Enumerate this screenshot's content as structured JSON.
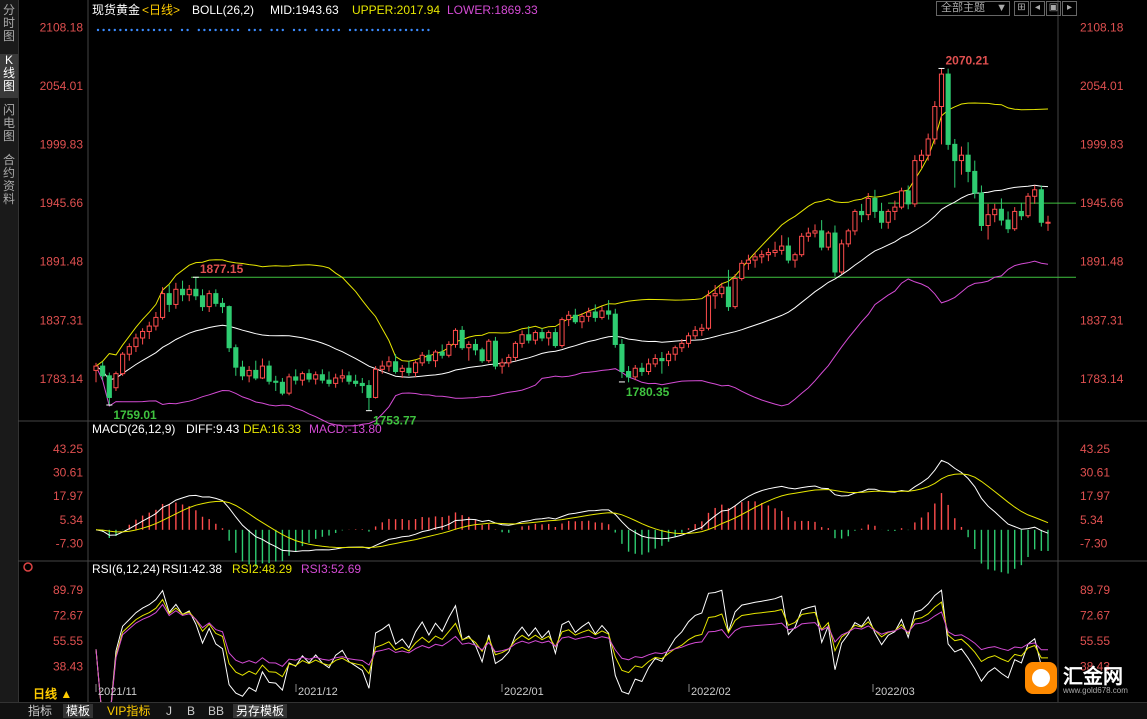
{
  "sidebar": {
    "tabs": [
      {
        "label": "分时图",
        "active": false
      },
      {
        "label": "K线图",
        "active": true
      },
      {
        "label": "闪电图",
        "active": false
      },
      {
        "label": "合约资料",
        "active": false
      }
    ]
  },
  "header": {
    "instrument": "现货黄金",
    "period": "<日线>",
    "boll_label": "BOLL(26,2)",
    "mid": "MID:1943.63",
    "upper": "UPPER:2017.94",
    "lower": "LOWER:1869.33",
    "dropdown": "全部主题",
    "colors": {
      "mid": "#ffffff",
      "upper": "#e6e600",
      "lower": "#d44bd4",
      "up": "#ff4d4d",
      "down": "#2ecc71"
    }
  },
  "bottom": {
    "period_btn": "日线 ▲",
    "tabs": [
      "指标",
      "模板",
      "VIP指标",
      "J",
      "B",
      "BB",
      "另存模板"
    ],
    "dates": [
      "2021/11",
      "2021/12",
      "2022/01",
      "2022/02",
      "2022/03"
    ]
  },
  "logo": {
    "text": "汇金网",
    "url_text": "www.gold678.com"
  },
  "chart_data": [
    {
      "type": "candlestick",
      "title": "现货黄金<日线>",
      "indicator": "BOLL(26,2)",
      "ylim": [
        1747,
        2115
      ],
      "y_ticks": [
        "2108.18",
        "2054.01",
        "1999.83",
        "1945.66",
        "1891.48",
        "1837.31",
        "1783.14"
      ],
      "annotations": [
        {
          "label": "1877.15",
          "bar": 15
        },
        {
          "label": "1759.01",
          "bar": 2
        },
        {
          "label": "1753.77",
          "bar": 41
        },
        {
          "label": "1780.35",
          "bar": 79
        },
        {
          "label": "2070.21",
          "bar": 127
        }
      ],
      "hlines": [
        1945.66,
        1877.15
      ],
      "ohlc": [
        [
          1791,
          1798,
          1780,
          1795
        ],
        [
          1795,
          1799,
          1782,
          1786
        ],
        [
          1786,
          1789,
          1759,
          1766
        ],
        [
          1775,
          1790,
          1772,
          1788
        ],
        [
          1788,
          1808,
          1786,
          1806
        ],
        [
          1806,
          1816,
          1800,
          1813
        ],
        [
          1813,
          1825,
          1808,
          1821
        ],
        [
          1821,
          1830,
          1815,
          1827
        ],
        [
          1827,
          1836,
          1820,
          1832
        ],
        [
          1832,
          1845,
          1828,
          1840
        ],
        [
          1840,
          1868,
          1838,
          1862
        ],
        [
          1862,
          1870,
          1845,
          1852
        ],
        [
          1852,
          1872,
          1848,
          1866
        ],
        [
          1866,
          1874,
          1855,
          1861
        ],
        [
          1861,
          1870,
          1855,
          1866
        ],
        [
          1866,
          1877,
          1856,
          1860
        ],
        [
          1860,
          1866,
          1846,
          1850
        ],
        [
          1850,
          1865,
          1845,
          1862
        ],
        [
          1862,
          1866,
          1850,
          1853
        ],
        [
          1853,
          1858,
          1844,
          1850
        ],
        [
          1850,
          1851,
          1808,
          1812
        ],
        [
          1812,
          1815,
          1786,
          1794
        ],
        [
          1794,
          1800,
          1782,
          1786
        ],
        [
          1786,
          1795,
          1780,
          1791
        ],
        [
          1791,
          1800,
          1782,
          1784
        ],
        [
          1784,
          1802,
          1783,
          1795
        ],
        [
          1795,
          1800,
          1778,
          1781
        ],
        [
          1781,
          1786,
          1772,
          1780
        ],
        [
          1780,
          1784,
          1768,
          1770
        ],
        [
          1770,
          1788,
          1768,
          1785
        ],
        [
          1785,
          1792,
          1778,
          1782
        ],
        [
          1782,
          1790,
          1777,
          1788
        ],
        [
          1788,
          1792,
          1780,
          1783
        ],
        [
          1783,
          1790,
          1778,
          1787
        ],
        [
          1787,
          1792,
          1779,
          1782
        ],
        [
          1782,
          1790,
          1776,
          1779
        ],
        [
          1779,
          1788,
          1775,
          1784
        ],
        [
          1784,
          1792,
          1780,
          1786
        ],
        [
          1786,
          1790,
          1778,
          1781
        ],
        [
          1781,
          1787,
          1776,
          1779
        ],
        [
          1779,
          1784,
          1770,
          1777
        ],
        [
          1777,
          1782,
          1754,
          1766
        ],
        [
          1766,
          1795,
          1765,
          1792
        ],
        [
          1792,
          1800,
          1788,
          1795
        ],
        [
          1795,
          1804,
          1790,
          1799
        ],
        [
          1799,
          1806,
          1788,
          1790
        ],
        [
          1790,
          1796,
          1784,
          1793
        ],
        [
          1793,
          1800,
          1786,
          1789
        ],
        [
          1789,
          1800,
          1785,
          1798
        ],
        [
          1798,
          1808,
          1795,
          1805
        ],
        [
          1805,
          1810,
          1797,
          1800
        ],
        [
          1800,
          1810,
          1794,
          1808
        ],
        [
          1808,
          1815,
          1802,
          1805
        ],
        [
          1805,
          1818,
          1803,
          1815
        ],
        [
          1815,
          1830,
          1812,
          1828
        ],
        [
          1828,
          1832,
          1810,
          1812
        ],
        [
          1812,
          1818,
          1800,
          1815
        ],
        [
          1815,
          1820,
          1805,
          1810
        ],
        [
          1810,
          1812,
          1798,
          1800
        ],
        [
          1800,
          1820,
          1798,
          1818
        ],
        [
          1818,
          1822,
          1792,
          1795
        ],
        [
          1795,
          1802,
          1788,
          1798
        ],
        [
          1798,
          1806,
          1794,
          1803
        ],
        [
          1803,
          1818,
          1800,
          1816
        ],
        [
          1816,
          1828,
          1812,
          1824
        ],
        [
          1824,
          1832,
          1816,
          1819
        ],
        [
          1819,
          1828,
          1815,
          1826
        ],
        [
          1826,
          1830,
          1818,
          1821
        ],
        [
          1821,
          1828,
          1814,
          1826
        ],
        [
          1826,
          1830,
          1812,
          1814
        ],
        [
          1814,
          1840,
          1812,
          1838
        ],
        [
          1838,
          1846,
          1832,
          1842
        ],
        [
          1842,
          1848,
          1834,
          1836
        ],
        [
          1836,
          1844,
          1830,
          1841
        ],
        [
          1841,
          1849,
          1836,
          1845
        ],
        [
          1845,
          1852,
          1836,
          1840
        ],
        [
          1840,
          1850,
          1838,
          1846
        ],
        [
          1846,
          1856,
          1838,
          1843
        ],
        [
          1843,
          1848,
          1812,
          1815
        ],
        [
          1815,
          1820,
          1784,
          1790
        ],
        [
          1790,
          1795,
          1780,
          1785
        ],
        [
          1785,
          1796,
          1782,
          1793
        ],
        [
          1793,
          1798,
          1786,
          1790
        ],
        [
          1790,
          1802,
          1787,
          1797
        ],
        [
          1797,
          1806,
          1794,
          1802
        ],
        [
          1802,
          1808,
          1788,
          1800
        ],
        [
          1800,
          1809,
          1795,
          1806
        ],
        [
          1806,
          1814,
          1800,
          1812
        ],
        [
          1812,
          1820,
          1808,
          1816
        ],
        [
          1816,
          1826,
          1812,
          1823
        ],
        [
          1823,
          1832,
          1820,
          1828
        ],
        [
          1828,
          1834,
          1823,
          1830
        ],
        [
          1830,
          1865,
          1828,
          1860
        ],
        [
          1860,
          1870,
          1848,
          1862
        ],
        [
          1862,
          1872,
          1858,
          1868
        ],
        [
          1868,
          1884,
          1846,
          1850
        ],
        [
          1850,
          1880,
          1848,
          1876
        ],
        [
          1876,
          1893,
          1874,
          1890
        ],
        [
          1890,
          1898,
          1884,
          1893
        ],
        [
          1893,
          1900,
          1886,
          1896
        ],
        [
          1896,
          1902,
          1890,
          1898
        ],
        [
          1898,
          1904,
          1892,
          1900
        ],
        [
          1900,
          1910,
          1896,
          1902
        ],
        [
          1902,
          1916,
          1898,
          1906
        ],
        [
          1906,
          1914,
          1890,
          1893
        ],
        [
          1893,
          1900,
          1886,
          1898
        ],
        [
          1898,
          1918,
          1896,
          1915
        ],
        [
          1915,
          1923,
          1910,
          1918
        ],
        [
          1918,
          1926,
          1914,
          1920
        ],
        [
          1920,
          1930,
          1902,
          1905
        ],
        [
          1905,
          1920,
          1902,
          1918
        ],
        [
          1918,
          1925,
          1878,
          1882
        ],
        [
          1882,
          1912,
          1880,
          1908
        ],
        [
          1908,
          1922,
          1905,
          1920
        ],
        [
          1920,
          1940,
          1916,
          1938
        ],
        [
          1938,
          1945,
          1928,
          1935
        ],
        [
          1935,
          1955,
          1930,
          1950
        ],
        [
          1950,
          1958,
          1932,
          1938
        ],
        [
          1938,
          1946,
          1922,
          1928
        ],
        [
          1928,
          1940,
          1922,
          1938
        ],
        [
          1938,
          1948,
          1930,
          1942
        ],
        [
          1942,
          1960,
          1940,
          1957
        ],
        [
          1957,
          1962,
          1940,
          1945
        ],
        [
          1945,
          1990,
          1942,
          1985
        ],
        [
          1985,
          1995,
          1978,
          1990
        ],
        [
          1990,
          2010,
          1985,
          2005
        ],
        [
          2005,
          2040,
          2000,
          2035
        ],
        [
          2035,
          2070,
          2000,
          2065
        ],
        [
          2065,
          2070,
          1995,
          2000
        ],
        [
          2000,
          2005,
          1960,
          1985
        ],
        [
          1985,
          1998,
          1972,
          1990
        ],
        [
          1990,
          2002,
          1965,
          1975
        ],
        [
          1975,
          1985,
          1950,
          1955
        ],
        [
          1955,
          1962,
          1920,
          1925
        ],
        [
          1925,
          1945,
          1912,
          1935
        ],
        [
          1935,
          1945,
          1928,
          1940
        ],
        [
          1940,
          1950,
          1925,
          1930
        ],
        [
          1930,
          1938,
          1918,
          1922
        ],
        [
          1922,
          1942,
          1920,
          1938
        ],
        [
          1938,
          1946,
          1930,
          1934
        ],
        [
          1934,
          1955,
          1932,
          1952
        ],
        [
          1952,
          1962,
          1945,
          1958
        ],
        [
          1958,
          1962,
          1924,
          1928
        ],
        [
          1928,
          1934,
          1920,
          1928
        ]
      ]
    },
    {
      "type": "macd",
      "title": "MACD(26,12,9)",
      "diff": "DIFF:9.43",
      "dea": "DEA:16.33",
      "macd": "MACD:-13.80",
      "ylim": [
        -14,
        48
      ],
      "y_ticks": [
        "43.25",
        "30.61",
        "17.97",
        "5.34",
        "-7.30"
      ]
    },
    {
      "type": "rsi",
      "title": "RSI(6,12,24)",
      "rsi1": "RSI1:42.38",
      "rsi2": "RSI2:48.29",
      "rsi3": "RSI3:52.69",
      "ylim": [
        28,
        98
      ],
      "y_ticks": [
        "89.79",
        "72.67",
        "55.55",
        "38.43"
      ]
    }
  ]
}
